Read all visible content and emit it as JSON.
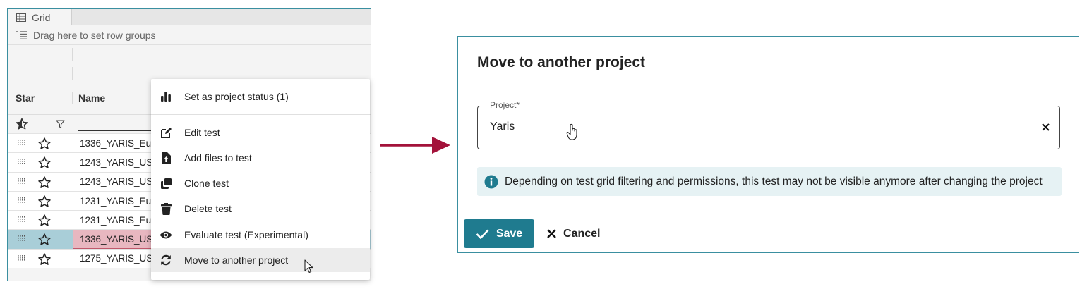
{
  "grid": {
    "tab_label": "Grid",
    "row_group_hint": "Drag here to set row groups",
    "columns": {
      "star": "Star",
      "name": "Name"
    },
    "rows": [
      {
        "name": "1336_YARIS_Eur",
        "selected": false
      },
      {
        "name": "1243_YARIS_US",
        "selected": false
      },
      {
        "name": "1243_YARIS_US",
        "selected": false
      },
      {
        "name": "1231_YARIS_Eur",
        "selected": false
      },
      {
        "name": "1231_YARIS_Eur",
        "selected": false
      },
      {
        "name": "1336_YARIS_US",
        "selected": true
      },
      {
        "name": "1275_YARIS_US",
        "selected": false
      }
    ]
  },
  "context_menu": {
    "items": [
      {
        "label": "Set as project status (1)",
        "icon": "bar-chart-icon"
      },
      {
        "label": "Edit test",
        "icon": "edit-icon"
      },
      {
        "label": "Add files to test",
        "icon": "file-upload-icon"
      },
      {
        "label": "Clone test",
        "icon": "clone-icon"
      },
      {
        "label": "Delete test",
        "icon": "trash-icon"
      },
      {
        "label": "Evaluate test (Experimental)",
        "icon": "eye-icon"
      },
      {
        "label": "Move to another project",
        "icon": "sync-icon",
        "hovered": true
      }
    ]
  },
  "dialog": {
    "title": "Move to another project",
    "project_field": {
      "label": "Project*",
      "value": "Yaris"
    },
    "info_text": "Depending on test grid filtering and permissions, this test may not be visible anymore after changing the project",
    "save_label": "Save",
    "cancel_label": "Cancel"
  },
  "colors": {
    "accent": "#1f7b8f",
    "arrow": "#a3123a",
    "info_bg": "#e6f2f4",
    "selected_row": "#a9ced8",
    "selected_cell": "#e8b7c0"
  }
}
